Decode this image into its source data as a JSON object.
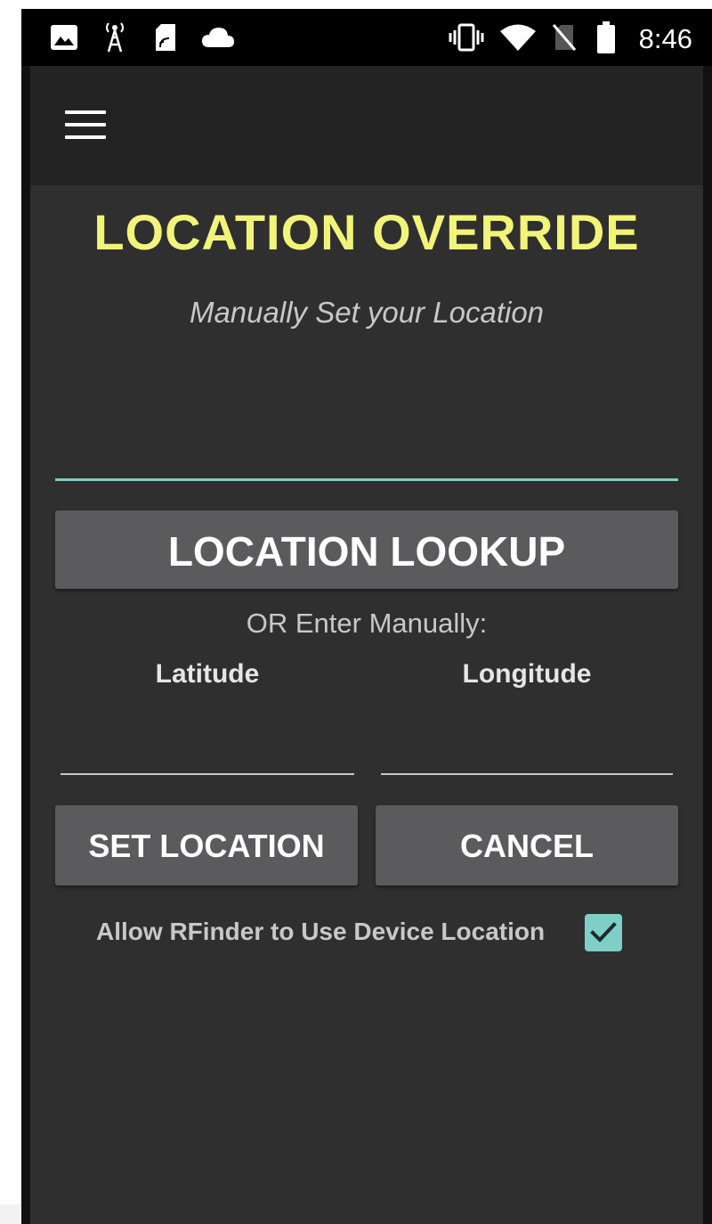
{
  "status_bar": {
    "time": "8:46",
    "left_icons": [
      "image-icon",
      "radio-tower-icon",
      "sim-card-icon",
      "cloud-icon"
    ],
    "right_icons": [
      "vibrate-icon",
      "wifi-icon",
      "no-sim-icon",
      "battery-icon"
    ]
  },
  "app_bar": {
    "menu_icon": "hamburger-menu-icon"
  },
  "content": {
    "title": "LOCATION OVERRIDE",
    "subtitle": "Manually Set your Location",
    "search_value": "",
    "lookup_button_label": "LOCATION LOOKUP",
    "or_text": "OR Enter Manually:",
    "latitude_label": "Latitude",
    "longitude_label": "Longitude",
    "latitude_value": "",
    "longitude_value": "",
    "set_location_label": "SET LOCATION",
    "cancel_label": "CANCEL",
    "allow_device_location_label": "Allow RFinder to Use Device Location",
    "allow_device_location_checked": true
  },
  "colors": {
    "title": "#f2f47a",
    "accent": "#7fcfc6",
    "button": "#5b5b5d",
    "background": "#2f2f2f",
    "app_bar": "#232323"
  }
}
